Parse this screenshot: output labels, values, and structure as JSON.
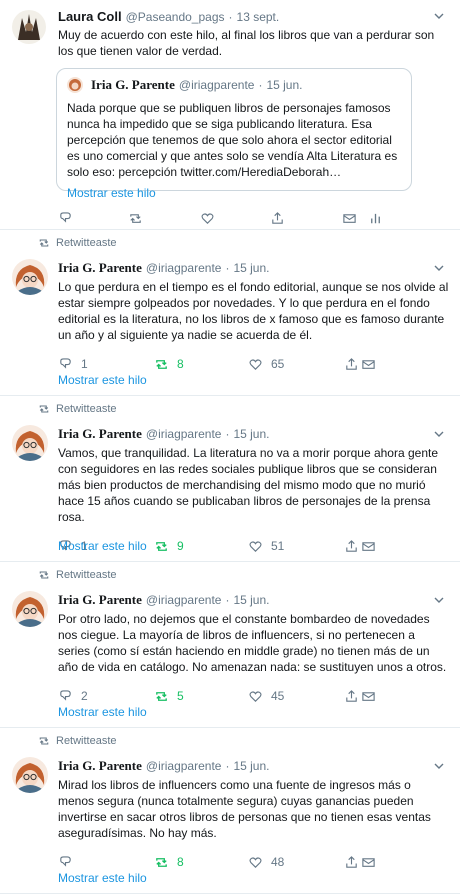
{
  "tweets": [
    {
      "name": "Laura Coll",
      "handle": "@Paseando_pags",
      "date": "13 sept.",
      "text": "Muy de acuerdo con este hilo, al final los libros que van a perdurar son los que tienen valor de verdad.",
      "quote": {
        "name": "Iria G. Parente",
        "handle": "@iriagparente",
        "date": "15 jun.",
        "text": "Nada porque que se publiquen libros de personajes famosos nunca ha impedido que se siga publicando literatura. Esa percepción que tenemos de que solo ahora el sector editorial es uno comercial y que antes solo se vendía Alta Literatura es solo eso: percepción twitter.com/HerediaDeborah…",
        "show_thread": "Mostrar este hilo"
      }
    },
    {
      "retweeted_label": "Retwitteaste",
      "name": "Iria G. Parente",
      "handle": "@iriagparente",
      "date": "15 jun.",
      "text": "Lo que perdura en el tiempo es el fondo editorial, aunque se nos olvide al estar siempre golpeados por novedades. Y lo que perdura en el fondo editorial es la literatura, no los libros de x famoso que es famoso durante un año y al siguiente ya nadie se acuerda de él.",
      "replies": "1",
      "retweets": "8",
      "likes": "65",
      "show_thread": "Mostrar este hilo"
    },
    {
      "retweeted_label": "Retwitteaste",
      "name": "Iria G. Parente",
      "handle": "@iriagparente",
      "date": "15 jun.",
      "text": "Vamos, que tranquilidad. La literatura no va a morir porque ahora gente con seguidores en las redes sociales publique libros que se consideran más bien productos de merchandising del mismo modo que no murió hace 15 años cuando se publicaban libros de personajes de la prensa rosa.",
      "replies": "1",
      "retweets": "9",
      "likes": "51",
      "show_thread": "Mostrar este hilo"
    },
    {
      "retweeted_label": "Retwitteaste",
      "name": "Iria G. Parente",
      "handle": "@iriagparente",
      "date": "15 jun.",
      "text": "Por otro lado, no dejemos que el constante bombardeo de novedades nos ciegue. La mayoría de libros de influencers, si no pertenecen a series (como sí están haciendo en middle grade) no tienen más de un año de vida en catálogo. No amenazan nada: se sustituyen unos a otros.",
      "replies": "2",
      "retweets": "5",
      "likes": "45",
      "show_thread": "Mostrar este hilo"
    },
    {
      "retweeted_label": "Retwitteaste",
      "name": "Iria G. Parente",
      "handle": "@iriagparente",
      "date": "15 jun.",
      "text": "Mirad los libros de influencers como una fuente de ingresos más o menos segura (nunca totalmente segura) cuyas ganancias pueden invertirse en sacar otros libros de personas que no tienen esas ventas aseguradísimas. No hay más.",
      "replies": "",
      "retweets": "8",
      "likes": "48",
      "show_thread": "Mostrar este hilo"
    }
  ],
  "colors": {
    "link": "#1b95e0",
    "retweet_active": "#17bf63",
    "muted": "#657786",
    "border": "#e6ecf0"
  },
  "icons": [
    "reply-icon",
    "retweet-icon",
    "like-icon",
    "share-icon",
    "dm-icon",
    "analytics-icon",
    "chevron-down-icon"
  ]
}
